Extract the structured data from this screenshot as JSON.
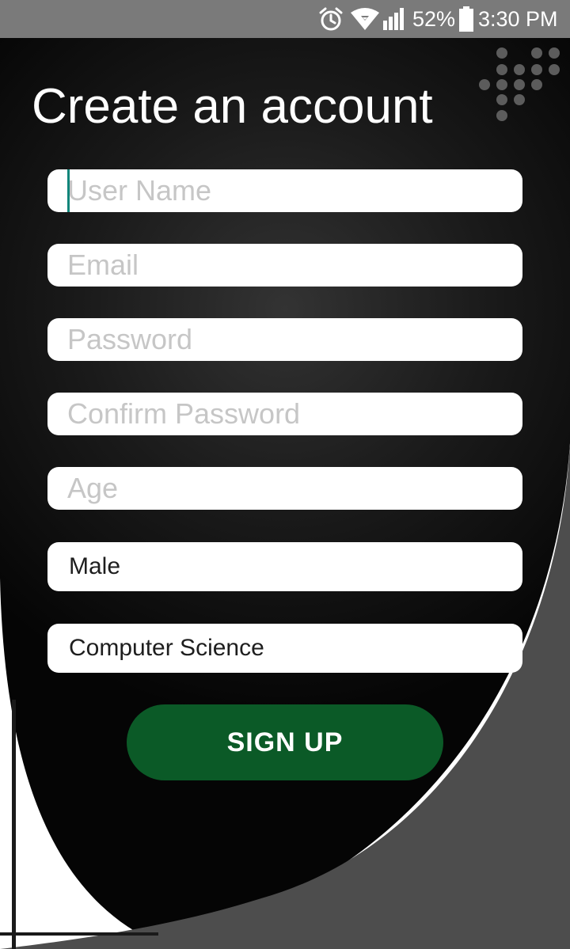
{
  "status_bar": {
    "icons": [
      "alarm-icon",
      "wifi-icon",
      "signal-icon",
      "battery-icon"
    ],
    "battery": "52%",
    "time": "3:30 PM"
  },
  "title": "Create an account",
  "form": {
    "username_placeholder": "User Name",
    "email_placeholder": "Email",
    "password_placeholder": "Password",
    "confirm_password_placeholder": "Confirm Password",
    "age_placeholder": "Age",
    "gender_value": "Male",
    "department_value": "Computer Science"
  },
  "signup_button": "SIGN UP",
  "colors": {
    "status_bar": "#7a7a7a",
    "panel": "#0b0b0b",
    "button": "#0b5a27",
    "cursor": "#11857a",
    "gray_shape": "#4d4d4d"
  }
}
